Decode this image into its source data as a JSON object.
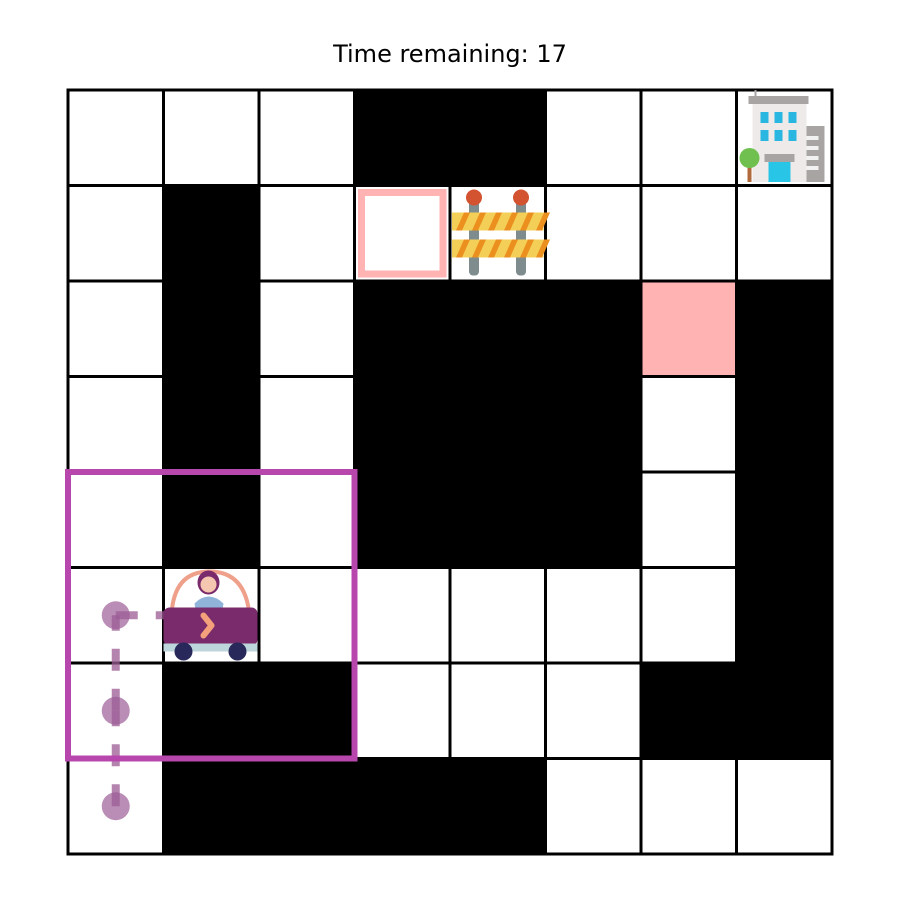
{
  "header": {
    "time_label": "Time remaining: 17"
  },
  "grid": {
    "rows": 8,
    "cols": 8,
    "cells": [
      [
        "empty",
        "empty",
        "empty",
        "wall",
        "wall",
        "empty",
        "empty",
        "goal"
      ],
      [
        "empty",
        "wall",
        "empty",
        "target-outline",
        "barrier",
        "empty",
        "empty",
        "empty"
      ],
      [
        "empty",
        "wall",
        "empty",
        "wall",
        "wall",
        "wall",
        "target-filled",
        "wall"
      ],
      [
        "empty",
        "wall",
        "empty",
        "wall",
        "wall",
        "wall",
        "empty",
        "wall"
      ],
      [
        "empty",
        "wall",
        "empty",
        "wall",
        "wall",
        "wall",
        "empty",
        "wall"
      ],
      [
        "empty",
        "car",
        "empty",
        "empty",
        "empty",
        "empty",
        "empty",
        "wall"
      ],
      [
        "empty",
        "wall",
        "wall",
        "empty",
        "empty",
        "empty",
        "wall",
        "wall"
      ],
      [
        "empty",
        "wall",
        "wall",
        "wall",
        "wall",
        "empty",
        "empty",
        "empty"
      ]
    ]
  },
  "agent": {
    "row": 5,
    "col": 1,
    "heading": "right",
    "icon": "car-with-driver-icon"
  },
  "goal": {
    "row": 0,
    "col": 7,
    "icon": "office-building-icon"
  },
  "obstacle": {
    "row": 1,
    "col": 4,
    "icon": "road-barrier-icon"
  },
  "view_window": {
    "row_start": 4,
    "row_end": 6,
    "col_start": 0,
    "col_end": 2
  },
  "trail": [
    {
      "row": 7,
      "col": 0
    },
    {
      "row": 6,
      "col": 0
    },
    {
      "row": 5,
      "col": 0
    },
    {
      "row": 5,
      "col": 1
    }
  ],
  "colors": {
    "wall": "#000000",
    "empty": "#ffffff",
    "target": "#ffb3b3",
    "view_window": "#b847ad",
    "trail": "#9b5c95",
    "car_body": "#7a2b6b"
  }
}
